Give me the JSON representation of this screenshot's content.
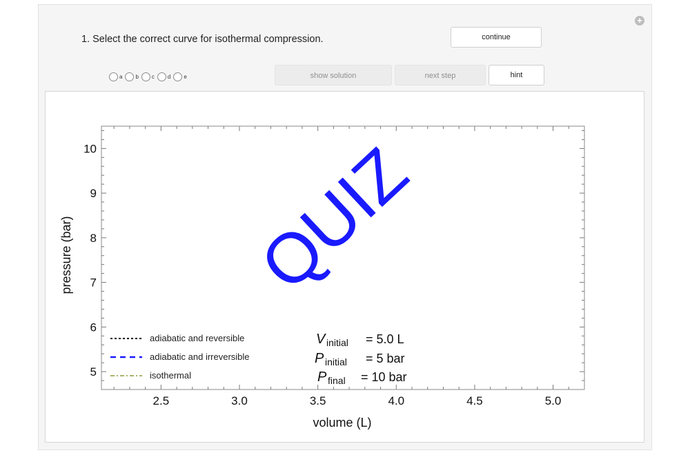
{
  "question": {
    "text": "1. Select the correct curve for isothermal compression."
  },
  "buttons": {
    "continue": "continue",
    "show_solution": "show solution",
    "next_step": "next step",
    "hint": "hint"
  },
  "choices": [
    {
      "label": "a"
    },
    {
      "label": "b"
    },
    {
      "label": "c"
    },
    {
      "label": "d"
    },
    {
      "label": "e"
    }
  ],
  "icons": {
    "expand": "plus-icon"
  },
  "colors": {
    "quiz": "#1a1aff",
    "adiabatic_irreversible": "#1a1aff",
    "adiabatic_reversible": "#000000",
    "isothermal": "#8a9a3a"
  },
  "plot": {
    "watermark": "QUIZ",
    "params": {
      "v_initial": {
        "sym": "V",
        "sub": "initial",
        "value": "= 5.0 L"
      },
      "p_initial": {
        "sym": "P",
        "sub": "initial",
        "value": "= 5 bar"
      },
      "p_final": {
        "sym": "P",
        "sub": "final",
        "value": "= 10 bar"
      }
    }
  },
  "chart_data": {
    "type": "line",
    "title": "",
    "xlabel": "volume (L)",
    "ylabel": "pressure (bar)",
    "xlim": [
      2.12,
      5.2
    ],
    "ylim": [
      4.6,
      10.5
    ],
    "x_ticks": [
      "2.5",
      "3.0",
      "3.5",
      "4.0",
      "4.5",
      "5.0"
    ],
    "y_ticks": [
      "5",
      "6",
      "7",
      "8",
      "9",
      "10"
    ],
    "series": [
      {
        "name": "adiabatic and reversible",
        "style": "dotted",
        "color": "#000000",
        "values": []
      },
      {
        "name": "adiabatic and irreversible",
        "style": "dashed",
        "color": "#1a1aff",
        "values": []
      },
      {
        "name": "isothermal",
        "style": "dash-dot",
        "color": "#8a9a3a",
        "values": []
      }
    ],
    "legend_position": "bottom-left",
    "grid": false
  }
}
